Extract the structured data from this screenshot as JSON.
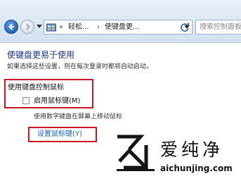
{
  "address_bar": {
    "breadcrumb_prefix": "«",
    "crumb_1": "轻松...",
    "separator": "›",
    "crumb_2": "使键盘更...",
    "search_placeholder": "搜索控制面板"
  },
  "content": {
    "title": "使键盘更易于使用",
    "description": "如果选择这些设置，则在每次登录时都将自动启动。",
    "section_header": "使用键盘控制鼠标",
    "checkbox": {
      "label": "启用鼠标键(M)",
      "checked": false
    },
    "checkbox_description": "使用数字键盘在屏幕上移动鼠标",
    "setup_link": "设置鼠标键(Y)"
  },
  "colors": {
    "title": "#1e3287",
    "link": "#1a5fb4",
    "highlight": "#c8171e"
  },
  "watermark": {
    "brand": "爱纯净",
    "url": "aichunjing.com"
  }
}
